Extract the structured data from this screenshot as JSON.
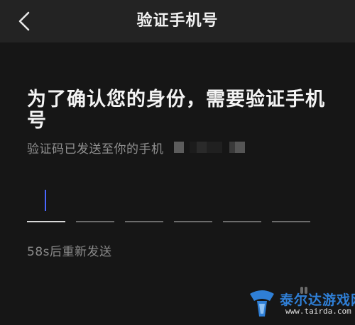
{
  "nav": {
    "title": "验证手机号",
    "back_icon": "chevron-left-icon"
  },
  "heading": "为了确认您的身份，需要验证手机号",
  "subtext": "验证码已发送至你的手机",
  "code_input": {
    "length": 6,
    "values": [
      "",
      "",
      "",
      "",
      "",
      ""
    ],
    "active_index": 0
  },
  "resend": "58s后重新发送",
  "watermark": {
    "text": "泰尔达游戏网",
    "url": "www.tairda.com"
  },
  "colors": {
    "background": "#161616",
    "nav_background": "#232323",
    "caret": "#4a66ff",
    "watermark_blue": "#2f7fd6"
  }
}
